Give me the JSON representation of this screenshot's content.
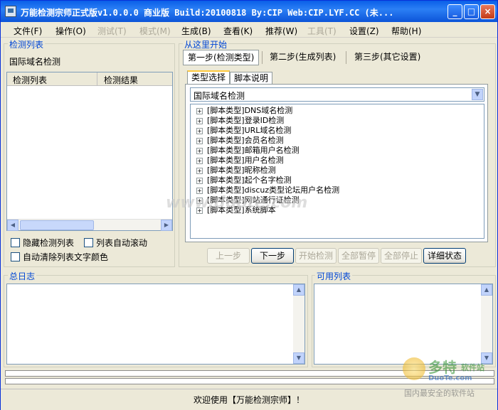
{
  "window": {
    "title": "万能检测宗师正式版v1.0.0.0 商业版 Build:20100818 By:CIP Web:CIP.LYF.CC (未...",
    "minimize_label": "_",
    "maximize_label": "□",
    "close_label": "×"
  },
  "menu": [
    {
      "label": "文件(F)",
      "enabled": true
    },
    {
      "label": "操作(O)",
      "enabled": true
    },
    {
      "label": "测试(T)",
      "enabled": false
    },
    {
      "label": "模式(M)",
      "enabled": false
    },
    {
      "label": "生成(B)",
      "enabled": true
    },
    {
      "label": "查看(K)",
      "enabled": true
    },
    {
      "label": "推荐(W)",
      "enabled": true
    },
    {
      "label": "工具(T)",
      "enabled": false
    },
    {
      "label": "设置(Z)",
      "enabled": true
    },
    {
      "label": "帮助(H)",
      "enabled": true
    }
  ],
  "left": {
    "group_label": "检测列表",
    "current_type": "国际域名检测",
    "columns": [
      "检测列表",
      "检测结果"
    ],
    "checkbox_hide": "隐藏检测列表",
    "checkbox_autoscroll": "列表自动滚动",
    "checkbox_autoclear": "自动清除列表文字颜色"
  },
  "right": {
    "group_label": "从这里开始",
    "steps": [
      "第一步(检测类型)",
      "第二步(生成列表)",
      "第三步(其它设置)"
    ],
    "tabs": [
      "类型选择",
      "脚本说明"
    ],
    "combo_value": "国际域名检测",
    "tree_items": [
      "[脚本类型]DNS域名检测",
      "[脚本类型]登录ID检测",
      "[脚本类型]URL域名检测",
      "[脚本类型]会员名检测",
      "[脚本类型]邮箱用户名检测",
      "[脚本类型]用户名检测",
      "[脚本类型]昵称检测",
      "[脚本类型]起个名字检测",
      "[脚本类型]discuz类型论坛用户名检测",
      "[脚本类型]网站通行证检测",
      "[脚本类型]系统脚本"
    ],
    "buttons": [
      {
        "label": "上一步",
        "enabled": false
      },
      {
        "label": "下一步",
        "enabled": true
      },
      {
        "label": "开始检测",
        "enabled": false
      },
      {
        "label": "全部暂停",
        "enabled": false
      },
      {
        "label": "全部停止",
        "enabled": false
      },
      {
        "label": "详细状态",
        "enabled": true
      }
    ]
  },
  "log": {
    "label": "总日志"
  },
  "available": {
    "label": "可用列表"
  },
  "status": {
    "text": "欢迎使用【万能检测宗师】！"
  },
  "watermarks": {
    "center": "www.duote.com",
    "logo_main": "多特",
    "logo_sub": "软件站",
    "logo_url": "DuoTe.com",
    "logo_slogan": "国内最安全的软件站"
  },
  "icons": {
    "app": "app-icon",
    "dropdown": "chevron-down-icon",
    "expand": "plus-box-icon"
  }
}
